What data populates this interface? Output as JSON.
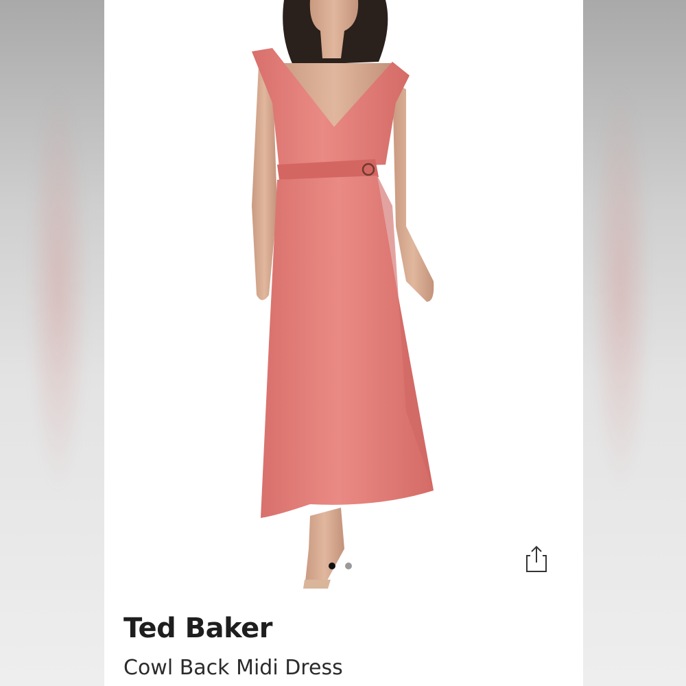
{
  "product": {
    "brand": "Ted Baker",
    "title": "Cowl Back Midi Dress"
  },
  "carousel": {
    "total_images": 2,
    "active_index": 0
  },
  "actions": {
    "share_icon": "share-icon"
  },
  "colors": {
    "dress": "#e17a76",
    "background": "#ffffff",
    "active_dot": "#111111",
    "inactive_dot": "#9a9a9a"
  }
}
